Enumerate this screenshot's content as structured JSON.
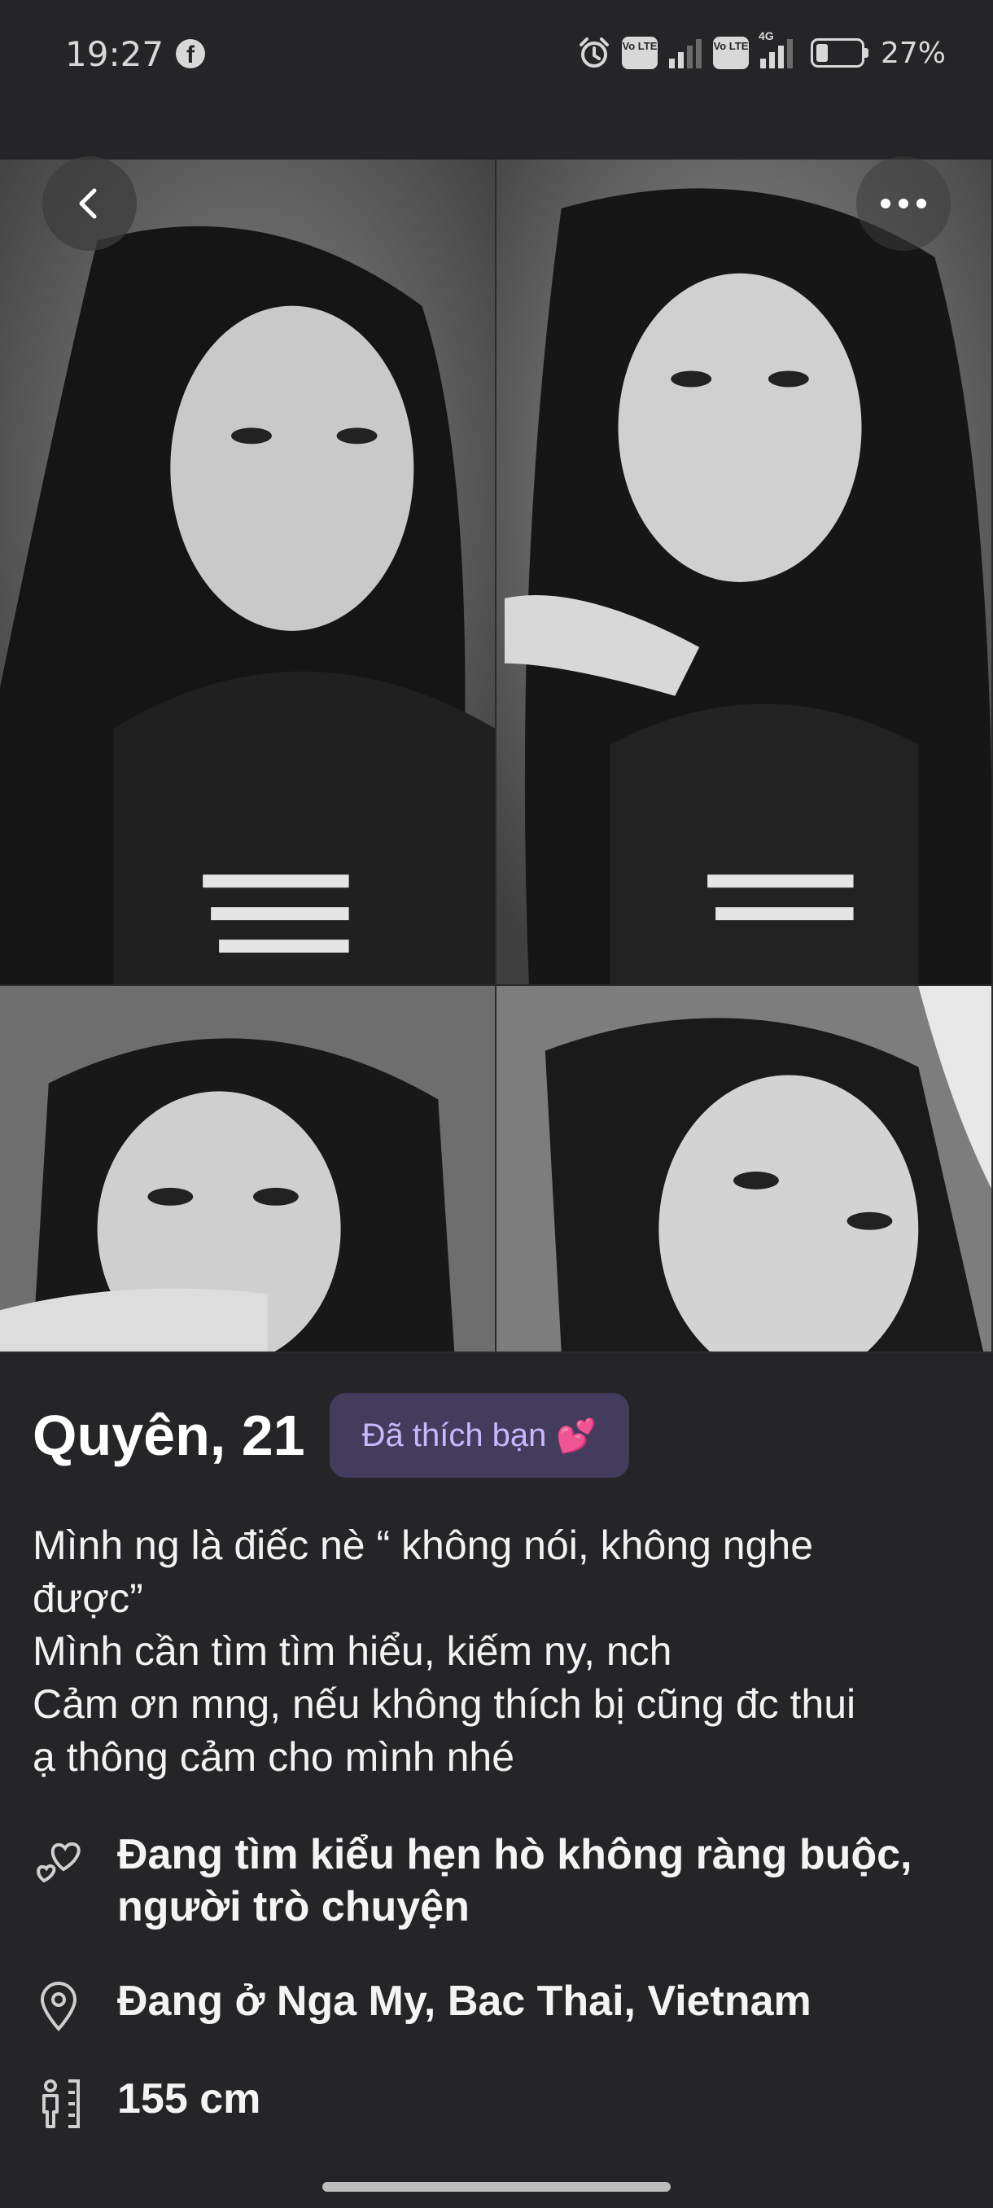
{
  "status_bar": {
    "time": "19:27",
    "facebook_glyph": "f",
    "volte_1": "Vo LTE",
    "volte_2": "Vo LTE",
    "network": "4G",
    "battery": "27%",
    "battery_level": 0.27
  },
  "toolbar": {
    "back_icon": "chevron-left-icon",
    "more_icon": "more-dots-icon"
  },
  "photos": [
    {
      "id": "photo-1",
      "tone": "bw-portrait"
    },
    {
      "id": "photo-2",
      "tone": "bw-portrait"
    },
    {
      "id": "photo-3",
      "tone": "bw-portrait"
    },
    {
      "id": "photo-4",
      "tone": "bw-portrait"
    }
  ],
  "profile": {
    "name_age": "Quyên, 21",
    "liked_badge": "Đã thích bạn",
    "liked_emoji": "💕",
    "bio_lines": [
      "Mình ng là điếc nè “ không nói, không nghe",
      "được”",
      "Mình cần tìm tìm hiểu, kiếm ny, nch",
      "Cảm ơn mng, nếu không thích bị cũng đc thui",
      "ạ thông cảm cho mình nhé"
    ],
    "details": [
      {
        "icon": "hearts-icon",
        "lines": [
          "Đang tìm kiểu hẹn hò không ràng buộc,",
          "người trò chuyện"
        ]
      },
      {
        "icon": "location-pin-icon",
        "lines": [
          "Đang ở Nga My, Bac Thai, Vietnam"
        ]
      },
      {
        "icon": "height-icon",
        "lines": [
          "155 cm"
        ]
      }
    ]
  },
  "colors": {
    "background": "#252527",
    "badge_bg": "#433c5c",
    "badge_text": "#c9b8ff"
  }
}
